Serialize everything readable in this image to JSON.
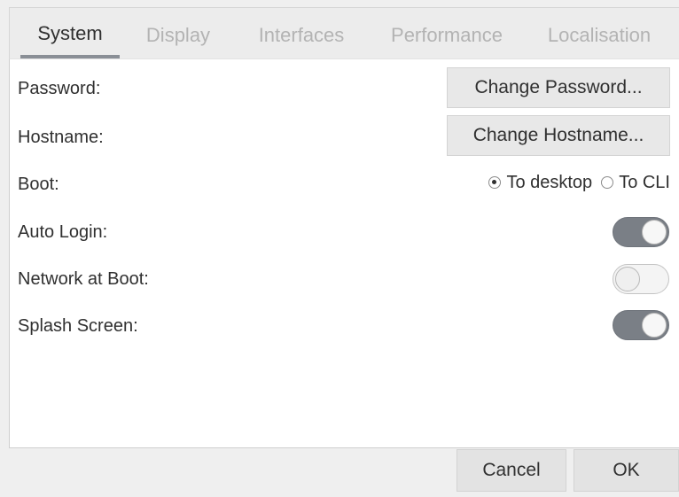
{
  "tabs": [
    {
      "label": "System",
      "active": true
    },
    {
      "label": "Display",
      "active": false
    },
    {
      "label": "Interfaces",
      "active": false
    },
    {
      "label": "Performance",
      "active": false
    },
    {
      "label": "Localisation",
      "active": false
    }
  ],
  "rows": {
    "password": {
      "label": "Password:",
      "button": "Change Password..."
    },
    "hostname": {
      "label": "Hostname:",
      "button": "Change Hostname..."
    },
    "boot": {
      "label": "Boot:",
      "options": [
        {
          "label": "To desktop",
          "selected": true
        },
        {
          "label": "To CLI",
          "selected": false
        }
      ]
    },
    "auto_login": {
      "label": "Auto Login:",
      "enabled": true
    },
    "network_at_boot": {
      "label": "Network at Boot:",
      "enabled": false
    },
    "splash_screen": {
      "label": "Splash Screen:",
      "enabled": true
    }
  },
  "footer": {
    "cancel_label": "Cancel",
    "ok_label": "OK"
  },
  "colors": {
    "toggle_on": "#7a7f86",
    "toggle_off": "#f4f4f4",
    "tab_active_underline": "#8a8f96"
  }
}
